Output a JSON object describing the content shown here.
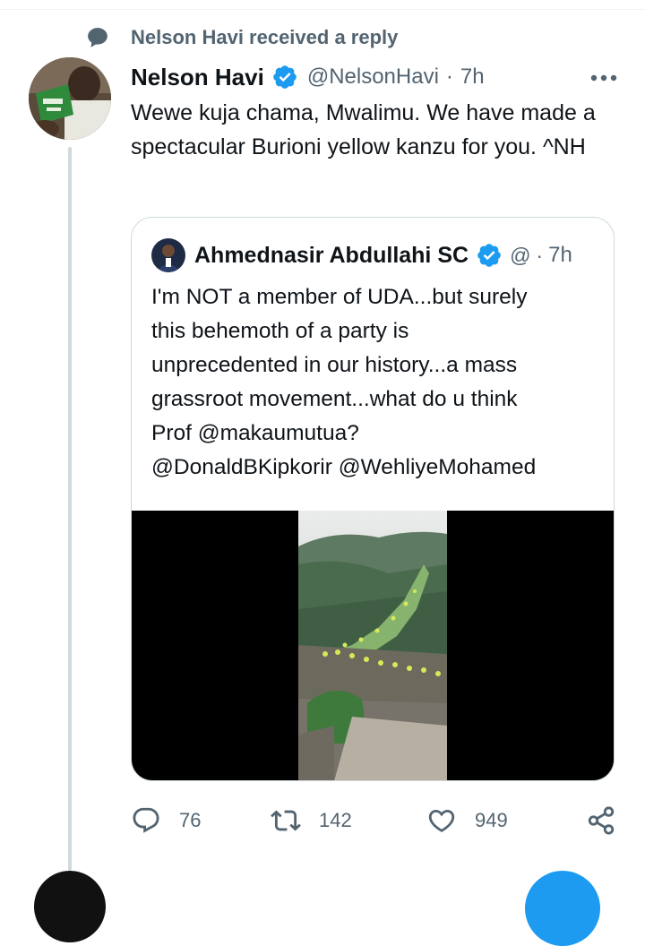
{
  "context": {
    "text": "Nelson Havi received a reply"
  },
  "tweet": {
    "display_name": "Nelson Havi",
    "handle": "@NelsonHavi",
    "separator": "·",
    "time": "7h",
    "text": "Wewe kuja chama, Mwalimu. We have made a spectacular Burioni yellow kanzu for you. ^NH"
  },
  "quote": {
    "display_name": "Ahmednasir Abdullahi SC",
    "handle": "@",
    "separator": "·",
    "time": "7h",
    "text_lines": [
      "I'm NOT  a member of UDA...but surely",
      "this behemoth of a party is",
      "unprecedented in our history...a mass",
      "grassroot movement...what do u think",
      "Prof @makaumutua?",
      "@DonaldBKipkorir @WehliyeMohamed"
    ]
  },
  "actions": {
    "reply_count": "76",
    "retweet_count": "142",
    "like_count": "949"
  },
  "colors": {
    "accent": "#1d9bf0",
    "secondary_text": "#536471",
    "border": "#cfd9de"
  },
  "icons": [
    "comment-bubble-icon",
    "verified-badge-icon",
    "more-icon",
    "reply-icon",
    "retweet-icon",
    "like-icon",
    "share-icon"
  ]
}
